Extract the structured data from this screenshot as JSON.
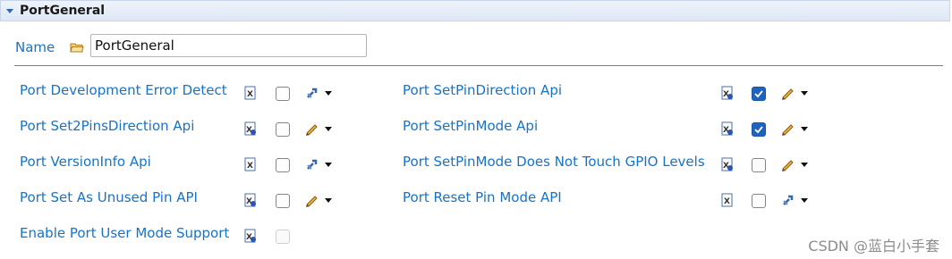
{
  "section": {
    "title": "PortGeneral"
  },
  "name_field": {
    "label": "Name",
    "value": "PortGeneral"
  },
  "params_left": [
    {
      "label": "Port Development Error Detect",
      "checked": false,
      "mode_icon": "config-wrench-icon"
    },
    {
      "label": "Port Set2PinsDirection Api",
      "checked": false,
      "mode_icon": "pencil-icon"
    },
    {
      "label": "Port VersionInfo Api",
      "checked": false,
      "mode_icon": "config-wrench-icon"
    },
    {
      "label": "Port Set As Unused Pin API",
      "checked": false,
      "mode_icon": "pencil-icon"
    },
    {
      "label": "Enable Port User Mode Support",
      "checked": false,
      "disabled": true
    }
  ],
  "params_right": [
    {
      "label": "Port SetPinDirection Api",
      "checked": true,
      "mode_icon": "pencil-icon"
    },
    {
      "label": "Port SetPinMode Api",
      "checked": true,
      "mode_icon": "pencil-icon"
    },
    {
      "label": "Port SetPinMode Does Not Touch GPIO Levels",
      "checked": false,
      "mode_icon": "pencil-icon"
    },
    {
      "label": "Port Reset Pin Mode API",
      "checked": false,
      "mode_icon": "config-wrench-icon"
    }
  ],
  "watermark": "CSDN @蓝白小手套",
  "colors": {
    "label": "#1673c8",
    "checkbox_checked": "#1e63bd",
    "header_bg": "#dfe8f6"
  }
}
